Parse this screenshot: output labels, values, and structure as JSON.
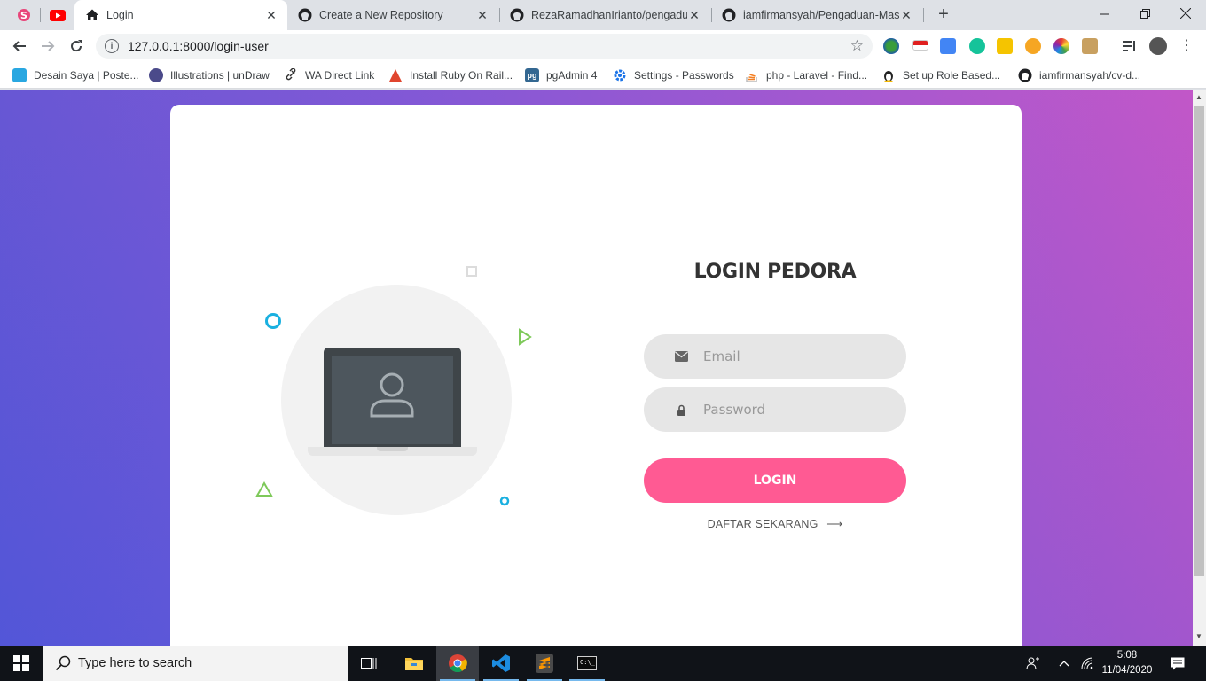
{
  "browser": {
    "tabs": [
      {
        "title": "Login",
        "icon": "home-icon",
        "active": true
      },
      {
        "title": "Create a New Repository",
        "icon": "github-icon",
        "active": false
      },
      {
        "title": "RezaRamadhanIrianto/pengaduan",
        "icon": "github-icon",
        "active": false
      },
      {
        "title": "iamfirmansyah/Pengaduan-Masyarakat",
        "icon": "github-icon",
        "active": false
      }
    ],
    "url": "127.0.0.1:8000/login-user",
    "bookmarks": [
      {
        "label": "Desain Saya | Poste...",
        "icon": "postermywall-icon",
        "color": "#29a7e1"
      },
      {
        "label": "Illustrations | unDraw",
        "icon": "undraw-icon",
        "color": "#4b4a8a"
      },
      {
        "label": "WA Direct Link",
        "icon": "link-icon",
        "color": "#333333"
      },
      {
        "label": "Install Ruby On Rail...",
        "icon": "gorails-icon",
        "color": "#e0452e"
      },
      {
        "label": "pgAdmin 4",
        "icon": "pgadmin-icon",
        "color": "#336791"
      },
      {
        "label": "Settings - Passwords",
        "icon": "gear-icon",
        "color": "#1a73e8"
      },
      {
        "label": "php - Laravel - Find...",
        "icon": "stackoverflow-icon",
        "color": "#f48024"
      },
      {
        "label": "Set up Role Based...",
        "icon": "linux-icon",
        "color": "#222222"
      },
      {
        "label": "iamfirmansyah/cv-d...",
        "icon": "github-icon",
        "color": "#222222"
      }
    ]
  },
  "login": {
    "title": "LOGIN PEDORA",
    "email_placeholder": "Email",
    "password_placeholder": "Password",
    "login_button": "LOGIN",
    "register_link": "DAFTAR SEKARANG"
  },
  "taskbar": {
    "search_placeholder": "Type here to search",
    "time": "5:08",
    "date": "11/04/2020"
  },
  "colors": {
    "accent_pink": "#ff5a93",
    "gradient_left": "#5a58d6",
    "gradient_right": "#c458c8",
    "deco_blue": "#1ab0e0",
    "deco_green": "#7ec95a"
  }
}
